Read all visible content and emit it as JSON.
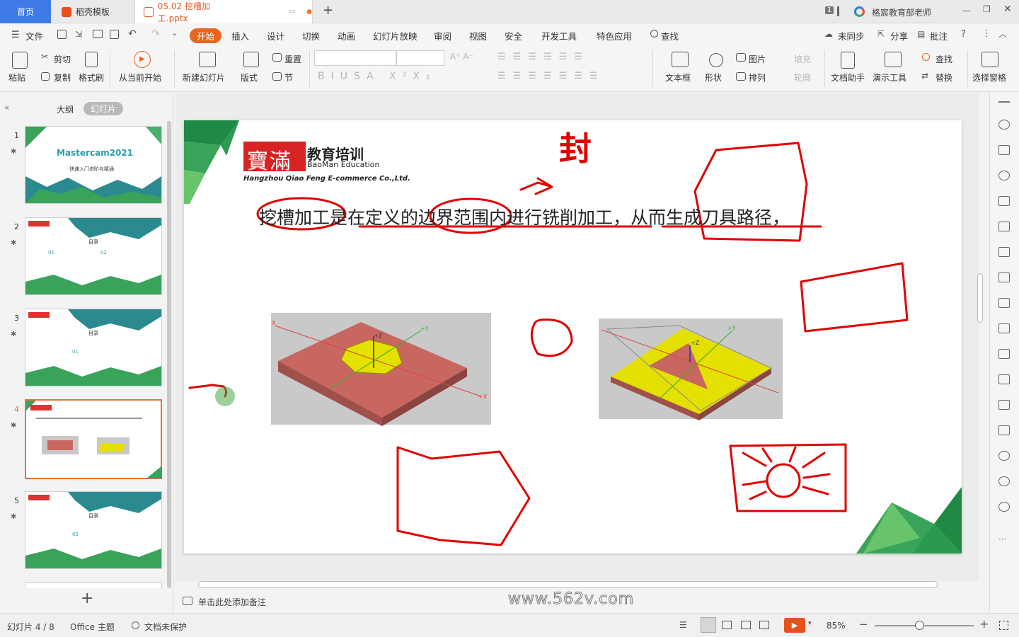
{
  "titlebar": {
    "home_tab": "首页",
    "templates_tab": "稻壳模板",
    "doc_tab": "05.02 挖槽加工.pptx",
    "new_tab": "+",
    "page_badge": "1",
    "user_name": "格宸教育部老师"
  },
  "menubar": {
    "file": "文件",
    "tabs": [
      "开始",
      "插入",
      "设计",
      "切换",
      "动画",
      "幻灯片放映",
      "审阅",
      "视图",
      "安全",
      "开发工具",
      "特色应用"
    ],
    "search": "查找",
    "sync": "未同步",
    "share": "分享",
    "comment": "批注"
  },
  "ribbon": {
    "paste": "粘贴",
    "cut": "剪切",
    "copy": "复制",
    "format_painter": "格式刷",
    "from_current": "从当前开始",
    "new_slide": "新建幻灯片",
    "layout": "版式",
    "reset": "重置",
    "section": "节",
    "textbox": "文本框",
    "shape": "形状",
    "picture": "图片",
    "arrange": "排列",
    "fill": "填充",
    "outline": "轮廓",
    "doc_assistant": "文档助手",
    "present_tools": "演示工具",
    "find": "查找",
    "replace": "替换",
    "select_pane": "选择窗格"
  },
  "leftpanel": {
    "outline_tab": "大纲",
    "slides_tab": "幻灯片",
    "add": "+",
    "thumbs": [
      {
        "num": "1",
        "title": "Mastercam2021",
        "sub": "快速入门进阶与精通"
      },
      {
        "num": "2",
        "title": "目录",
        "items": [
          "01",
          "02"
        ]
      },
      {
        "num": "3",
        "title": "目录",
        "items": [
          "01"
        ]
      },
      {
        "num": "4",
        "title": ""
      },
      {
        "num": "5",
        "title": "目录",
        "items": [
          "02"
        ]
      }
    ]
  },
  "slide": {
    "logo_cn": "寶滿",
    "logo_edu": "教育培训",
    "logo_en": "BaoMan Education",
    "company": "Hangzhou Qiao Feng E-commerce Co.,Ltd.",
    "body_text": "挖槽加工是在定义的边界范围内进行铣削加工，从而生成刀具路径，",
    "annot_seal": "封",
    "axis_z": "+Z",
    "axis_y": "+Y",
    "axis_x": "+X",
    "axis_xneg": "X"
  },
  "notes": {
    "placeholder": "单击此处添加备注"
  },
  "watermark": "www.562v.com",
  "statusbar": {
    "slide_info": "幻灯片 4 / 8",
    "theme": "Office 主题",
    "protect": "文档未保护",
    "zoom": "85%",
    "zoom_level": 0.45
  },
  "colors": {
    "accent": "#e8651e",
    "home_tab": "#3e7be8",
    "ink": "#e00000",
    "block_red": "#c86760",
    "pocket_yellow": "#e4e000"
  }
}
